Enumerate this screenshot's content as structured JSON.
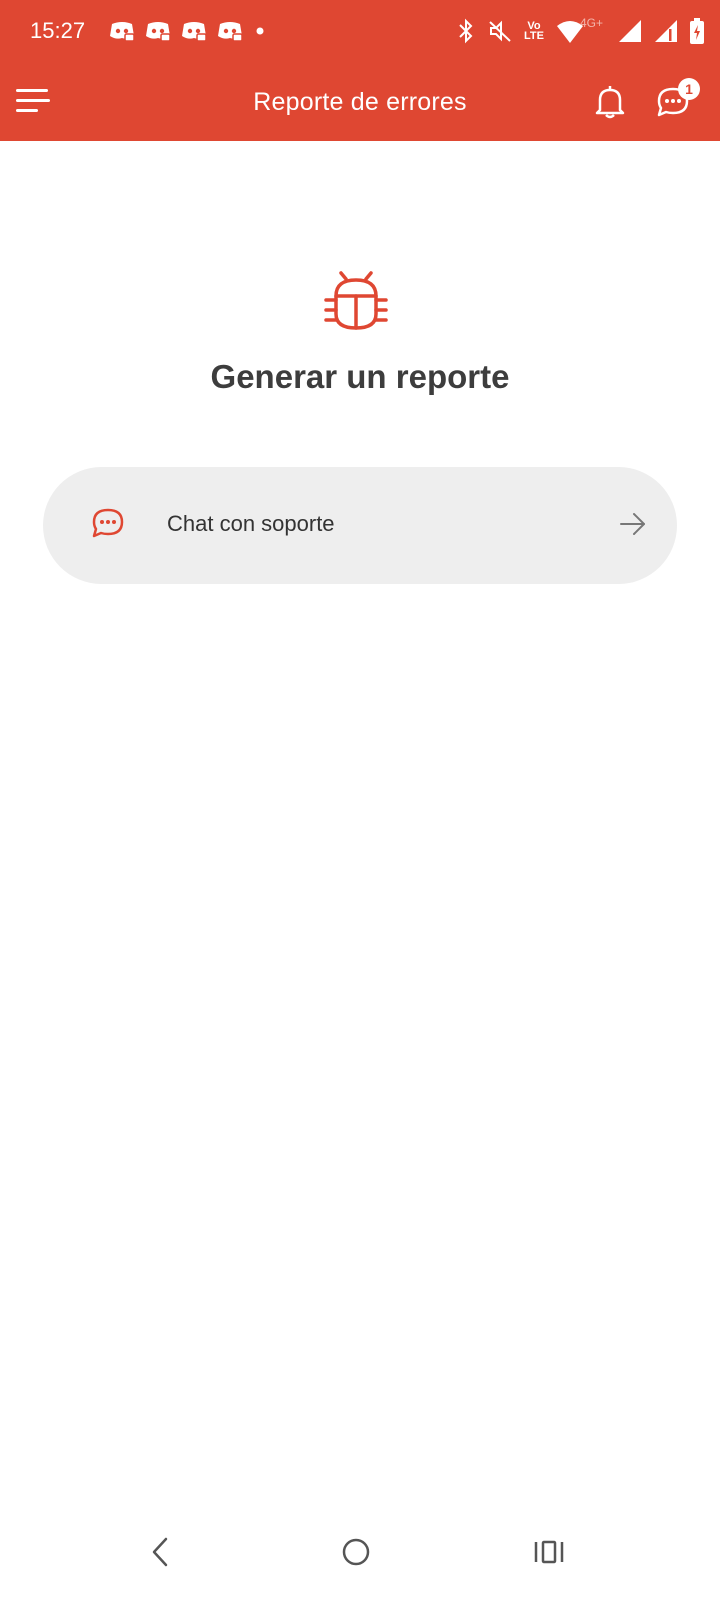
{
  "status_bar": {
    "time": "15:27",
    "notification_icons": [
      "discord-icon",
      "discord-icon",
      "discord-icon",
      "discord-icon"
    ],
    "right_icons": [
      "bluetooth-icon",
      "mute-icon",
      "volte-icon",
      "wifi-icon",
      "signal-icon",
      "signal-icon",
      "battery-icon"
    ],
    "network_label": "4G+",
    "volte_label_top": "Vo",
    "volte_label_bottom": "LTE"
  },
  "app_bar": {
    "title": "Reporte de errores",
    "menu_icon": "menu-icon",
    "bell_icon": "bell-icon",
    "chat_icon": "chat-icon",
    "chat_badge": "1"
  },
  "main": {
    "hero_icon": "bug-icon",
    "title": "Generar un reporte",
    "options": [
      {
        "label": "Chat con soporte",
        "icon": "chat-icon",
        "trailing_icon": "arrow-right-icon"
      }
    ]
  },
  "nav_bar": {
    "items": [
      "back-icon",
      "home-icon",
      "recents-icon"
    ]
  },
  "colors": {
    "accent": "#df4732",
    "card_bg": "#eeeeee",
    "title_text": "#3d3d3d"
  }
}
